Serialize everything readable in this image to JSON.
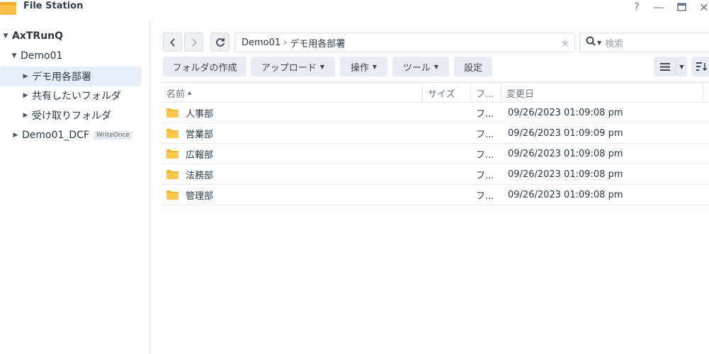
{
  "window": {
    "title": "File Station",
    "controls": {
      "help": "?",
      "minimize": "—",
      "maximize": "❐",
      "close": "✕"
    }
  },
  "sidebar": {
    "root": "AxTRunQ",
    "shares": [
      {
        "label": "Demo01",
        "expanded": true,
        "children": [
          {
            "label": "デモ用各部署",
            "selected": true
          },
          {
            "label": "共有したいフォルダ"
          },
          {
            "label": "受け取りフォルダ"
          }
        ]
      },
      {
        "label": "Demo01_DCF",
        "badge": "WriteOnce"
      }
    ]
  },
  "toolbar": {
    "path": {
      "share": "Demo01",
      "separator": "›",
      "folder": "デモ用各部署"
    },
    "search_placeholder": "検索",
    "buttons": {
      "create": "フォルダの作成",
      "upload": "アップロード",
      "action": "操作",
      "tools": "ツール",
      "settings": "設定"
    }
  },
  "table": {
    "headers": {
      "name": "名前",
      "size": "サイズ",
      "type": "フ...",
      "modified": "変更日"
    },
    "rows": [
      {
        "name": "人事部",
        "size": "",
        "type": "フ...",
        "modified": "09/26/2023 01:09:08 pm"
      },
      {
        "name": "営業部",
        "size": "",
        "type": "フ...",
        "modified": "09/26/2023 01:09:09 pm"
      },
      {
        "name": "広報部",
        "size": "",
        "type": "フ...",
        "modified": "09/26/2023 01:09:08 pm"
      },
      {
        "name": "法務部",
        "size": "",
        "type": "フ...",
        "modified": "09/26/2023 01:09:08 pm"
      },
      {
        "name": "管理部",
        "size": "",
        "type": "フ...",
        "modified": "09/26/2023 01:09:08 pm"
      }
    ]
  },
  "colors": {
    "accent": "#e6f0fb",
    "folder": "#f6b92b",
    "app_icon": "#f5a623"
  }
}
